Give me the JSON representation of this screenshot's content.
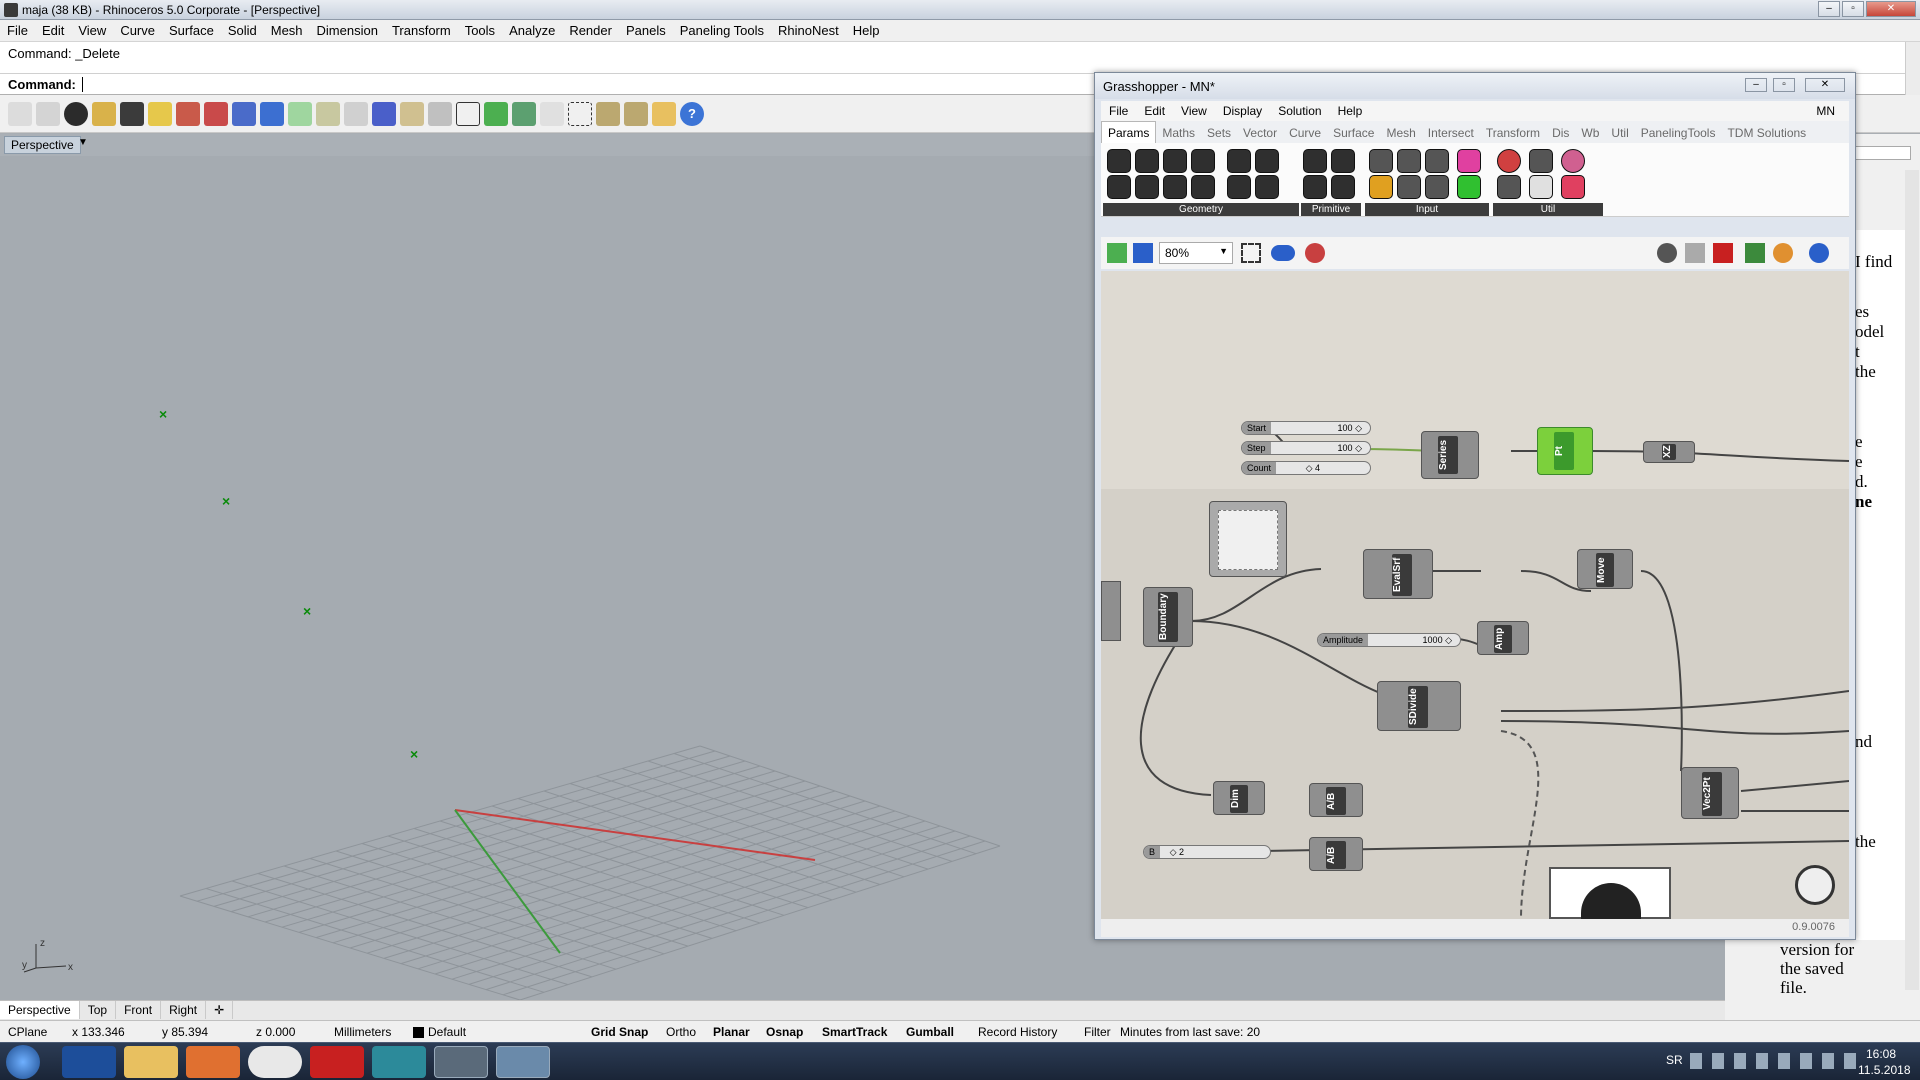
{
  "app": {
    "title": "maja (38 KB) - Rhinoceros 5.0 Corporate - [Perspective]"
  },
  "menu": [
    "File",
    "Edit",
    "View",
    "Curve",
    "Surface",
    "Solid",
    "Mesh",
    "Dimension",
    "Transform",
    "Tools",
    "Analyze",
    "Render",
    "Panels",
    "Paneling Tools",
    "RhinoNest",
    "Help"
  ],
  "command": {
    "history": "Command: _Delete",
    "prompt": "Command:"
  },
  "viewport": {
    "label": "Perspective",
    "tabs": [
      "Perspective",
      "Top",
      "Front",
      "Right"
    ]
  },
  "status": {
    "cplane": "CPlane",
    "x": "x 133.346",
    "y": "y 85.394",
    "z": "z 0.000",
    "units": "Millimeters",
    "layer": "Default",
    "toggles": [
      "Grid Snap",
      "Ortho",
      "Planar",
      "Osnap",
      "SmartTrack",
      "Gumball",
      "Record History",
      "Filter"
    ],
    "minutes": "Minutes from last save: 20"
  },
  "grasshopper": {
    "title": "Grasshopper - MN*",
    "menu": [
      "File",
      "Edit",
      "View",
      "Display",
      "Solution",
      "Help"
    ],
    "doc_tag": "MN",
    "tabs": [
      "Params",
      "Maths",
      "Sets",
      "Vector",
      "Curve",
      "Surface",
      "Mesh",
      "Intersect",
      "Transform",
      "Dis",
      "Wb",
      "Util",
      "PanelingTools",
      "TDM Solutions"
    ],
    "groups": [
      "Geometry",
      "Primitive",
      "Input",
      "Util"
    ],
    "zoom": "80%",
    "version": "0.9.0076",
    "sliders": {
      "start": "Start",
      "start_val": "100 ◇",
      "step": "Step",
      "step_val": "100 ◇",
      "count": "Count",
      "count_val": "◇ 4",
      "amp": "Amplitude",
      "amp_val": "1000 ◇",
      "b": "B",
      "b_val": "◇ 2"
    },
    "components": {
      "series": "Series",
      "pt": "Pt",
      "xz": "XZ",
      "boundary": "Boundary",
      "evalsrf": "EvalSrf",
      "move": "Move",
      "amp": "Amp",
      "sdivide": "SDivide",
      "dim": "Dim",
      "ab1": "A/B",
      "ab2": "A/B",
      "vec2pt": "Vec2Pt"
    }
  },
  "doc_panel": {
    "lines": [
      "I find",
      "es",
      "odel",
      "t",
      "the",
      "e",
      "e",
      "d.",
      "ne",
      "nd",
      "the",
      "version for",
      "the saved",
      "file."
    ]
  },
  "taskbar": {
    "lang": "SR",
    "time": "16:08",
    "date": "11.5.2018"
  }
}
